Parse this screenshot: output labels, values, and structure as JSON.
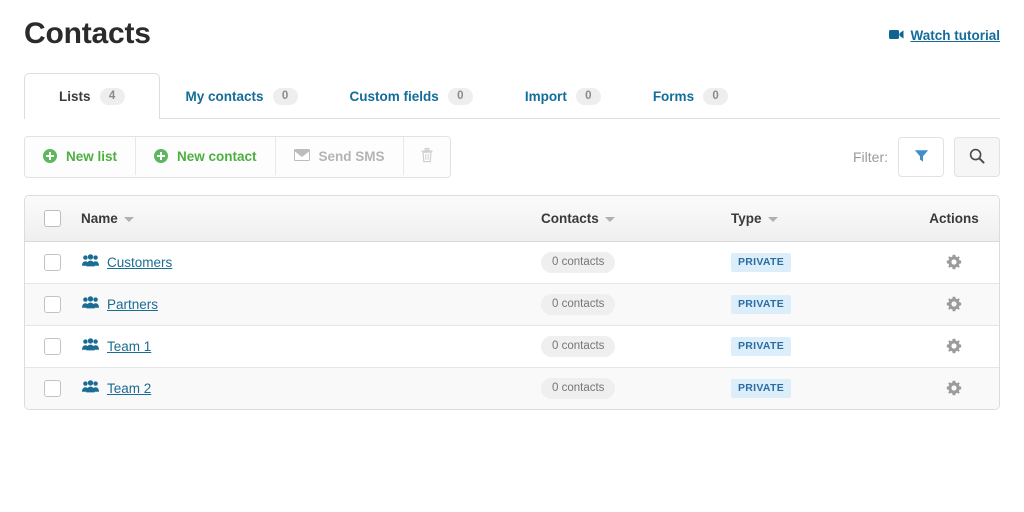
{
  "header": {
    "title": "Contacts",
    "tutorial_link_label": "Watch tutorial",
    "tutorial_icon": "video-camera-icon"
  },
  "tabs": [
    {
      "label": "Lists",
      "count": "4",
      "active": true
    },
    {
      "label": "My contacts",
      "count": "0",
      "active": false
    },
    {
      "label": "Custom fields",
      "count": "0",
      "active": false
    },
    {
      "label": "Import",
      "count": "0",
      "active": false
    },
    {
      "label": "Forms",
      "count": "0",
      "active": false
    }
  ],
  "toolbar": {
    "new_list_label": "New list",
    "new_contact_label": "New contact",
    "send_sms_label": "Send SMS",
    "delete_icon": "trash-icon",
    "filter_label": "Filter:",
    "filter_icon": "funnel-icon",
    "search_icon": "magnifier-icon"
  },
  "table": {
    "columns": [
      {
        "key": "check",
        "label": ""
      },
      {
        "key": "name",
        "label": "Name",
        "sortable": true
      },
      {
        "key": "contacts",
        "label": "Contacts",
        "sortable": true
      },
      {
        "key": "type",
        "label": "Type",
        "sortable": true
      },
      {
        "key": "actions",
        "label": "Actions",
        "sortable": false
      }
    ],
    "rows": [
      {
        "name": "Customers",
        "contacts": "0 contacts",
        "type": "PRIVATE",
        "icon": "group-icon",
        "action_icon": "gear-icon"
      },
      {
        "name": "Partners",
        "contacts": "0 contacts",
        "type": "PRIVATE",
        "icon": "group-icon",
        "action_icon": "gear-icon"
      },
      {
        "name": "Team 1",
        "contacts": "0 contacts",
        "type": "PRIVATE",
        "icon": "group-icon",
        "action_icon": "gear-icon"
      },
      {
        "name": "Team 2",
        "contacts": "0 contacts",
        "type": "PRIVATE",
        "icon": "group-icon",
        "action_icon": "gear-icon"
      }
    ]
  },
  "colors": {
    "link": "#136c99",
    "green_action": "#4caf3f",
    "badge_bg": "#ddeefb",
    "badge_text": "#2b6ca3",
    "pill_bg": "#efefef",
    "border": "#dcdcdc"
  }
}
